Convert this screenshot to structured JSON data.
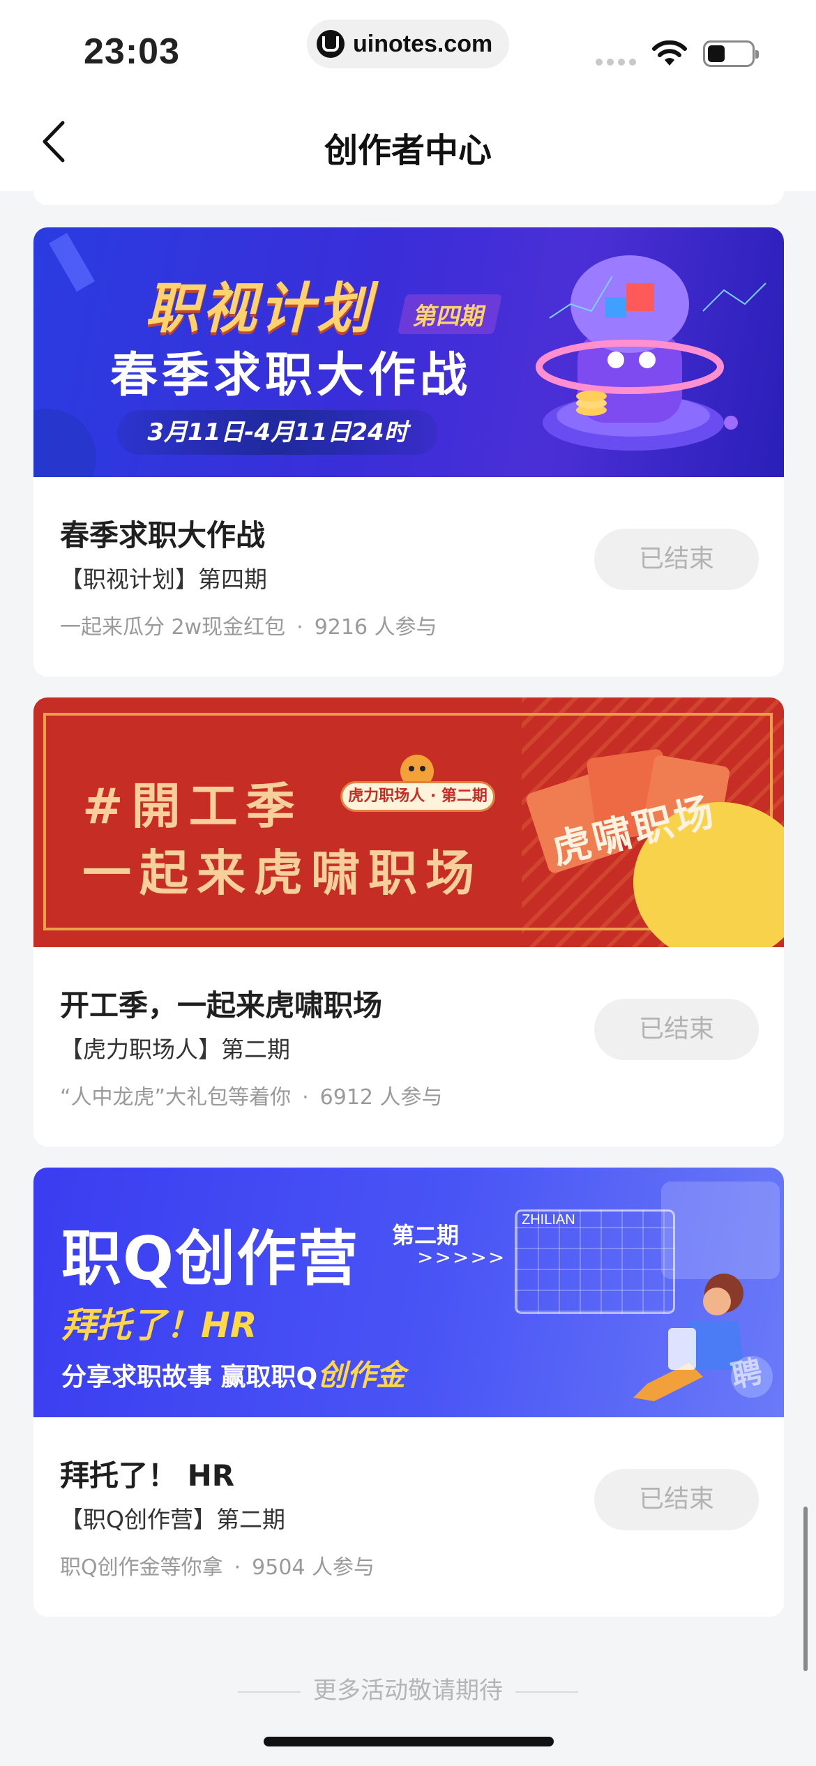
{
  "status_bar": {
    "time": "23:03",
    "url": "uinotes.com"
  },
  "navbar": {
    "title": "创作者中心"
  },
  "activities": [
    {
      "banner": {
        "line1": "职视计划",
        "tag": "第四期",
        "line2": "春季求职大作战",
        "date": "3月11日-4月11日24时"
      },
      "title": "春季求职大作战",
      "subtitle": "【职视计划】第四期",
      "reward": "一起来瓜分 2w现金红包",
      "participants": "9216 人参与",
      "status": "已结束"
    },
    {
      "banner": {
        "line1": "#開工季",
        "line2": "一起来虎啸职场",
        "pill": "虎力职场人 · 第二期",
        "envelope": "虎啸职场"
      },
      "title": "开工季，一起来虎啸职场",
      "subtitle": "【虎力职场人】第二期",
      "reward": "“人中龙虎”大礼包等着你",
      "participants": "6912 人参与",
      "status": "已结束"
    },
    {
      "banner": {
        "line1": "职Q创作营",
        "tag": "第二期",
        "arrows": ">>>>>",
        "line2": "拜托了！HR",
        "line3_prefix": "分享求职故事 赢取职Q",
        "line3_highlight": "创作金",
        "grid_label": "ZHILIAN",
        "badge": "聘"
      },
      "title": "拜托了！ HR",
      "subtitle": "【职Q创作营】第二期",
      "reward": "职Q创作金等你拿",
      "participants": "9504 人参与",
      "status": "已结束"
    }
  ],
  "footer": {
    "note": "更多活动敬请期待"
  },
  "colors": {
    "status_button_bg": "#f0f0f0",
    "status_button_text": "#b3b3b3",
    "page_bg": "#f4f5f7"
  }
}
